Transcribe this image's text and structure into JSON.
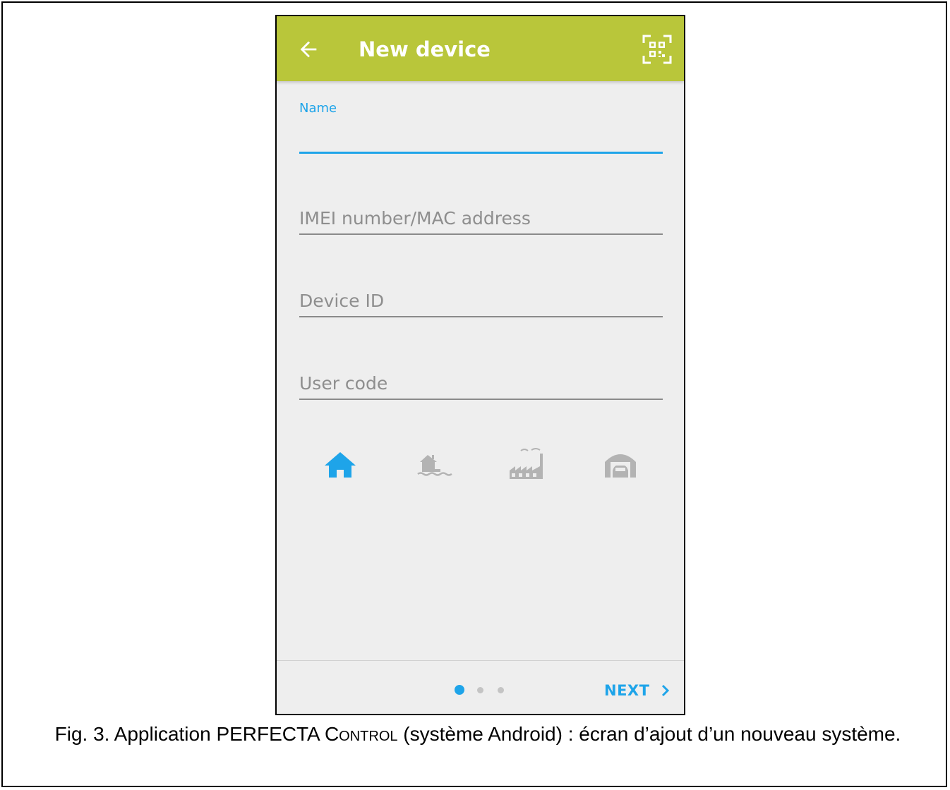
{
  "app_bar": {
    "title": "New device",
    "background_color": "#b9c63a",
    "back_icon": "arrow-back-icon",
    "scan_icon": "qr-code-scan-icon"
  },
  "form": {
    "name_label": "Name",
    "name_value": "",
    "imei_placeholder": "IMEI number/MAC address",
    "device_id_placeholder": "Device ID",
    "user_code_placeholder": "User code"
  },
  "object_types": [
    {
      "icon": "home-icon",
      "selected": true
    },
    {
      "icon": "house-by-water-icon",
      "selected": false
    },
    {
      "icon": "factory-icon",
      "selected": false
    },
    {
      "icon": "garage-icon",
      "selected": false
    }
  ],
  "pager": {
    "pages": 3,
    "current": 1
  },
  "bottom_bar": {
    "next_label": "NEXT"
  },
  "caption": {
    "before": "Fig. 3. Application PERFECTA C",
    "smallcaps": "ontrol",
    "after": " (système Android) : écran d’ajout d’un nouveau système."
  },
  "colors": {
    "accent": "#1ea4e9",
    "inactive_icon": "#b3b3b3",
    "screen_bg": "#eeeeee"
  }
}
